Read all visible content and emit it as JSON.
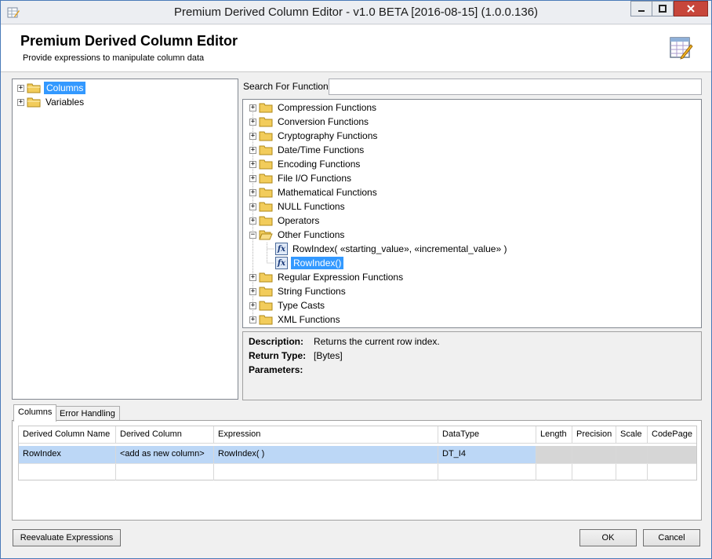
{
  "window": {
    "title": "Premium Derived Column Editor - v1.0 BETA [2016-08-15] (1.0.0.136)"
  },
  "header": {
    "title": "Premium Derived Column Editor",
    "subtitle": "Provide expressions to manipulate column data"
  },
  "left_tree": {
    "items": [
      {
        "label": "Columns",
        "selected": true
      },
      {
        "label": "Variables",
        "selected": false
      }
    ]
  },
  "search": {
    "label": "Search For Function:",
    "value": ""
  },
  "function_tree": {
    "categories": [
      "Compression Functions",
      "Conversion Functions",
      "Cryptography Functions",
      "Date/Time Functions",
      "Encoding Functions",
      "File I/O Functions",
      "Mathematical Functions",
      "NULL Functions",
      "Operators",
      "Other Functions",
      "Regular Expression Functions",
      "String Functions",
      "Type Casts",
      "XML Functions"
    ],
    "expanded_category": "Other Functions",
    "expanded_items": [
      "RowIndex( «starting_value», «incremental_value» )",
      "RowIndex()"
    ],
    "selected_item": "RowIndex()"
  },
  "description": {
    "description_label": "Description:",
    "description_value": "Returns the current row index.",
    "return_type_label": "Return Type:",
    "return_type_value": "[Bytes]",
    "parameters_label": "Parameters:",
    "parameters_value": ""
  },
  "tabs": [
    {
      "label": "Columns",
      "active": true
    },
    {
      "label": "Error Handling",
      "active": false
    }
  ],
  "grid": {
    "columns": [
      "Derived Column Name",
      "Derived Column",
      "Expression",
      "DataType",
      "Length",
      "Precision",
      "Scale",
      "CodePage"
    ],
    "rows": [
      [
        "RowIndex",
        "<add as new column>",
        "RowIndex( )",
        "DT_I4",
        "",
        "",
        "",
        ""
      ]
    ]
  },
  "buttons": {
    "reevaluate": "Reevaluate Expressions",
    "ok": "OK",
    "cancel": "Cancel"
  },
  "colors": {
    "selection": "#3399ff",
    "row_selected": "#bcd7f6",
    "accent_border": "#4a7ab8"
  },
  "icons": {
    "app": "editor-icon",
    "header": "spreadsheet-pencil-icon",
    "folder": "folder-icon",
    "function": "fx-icon"
  }
}
